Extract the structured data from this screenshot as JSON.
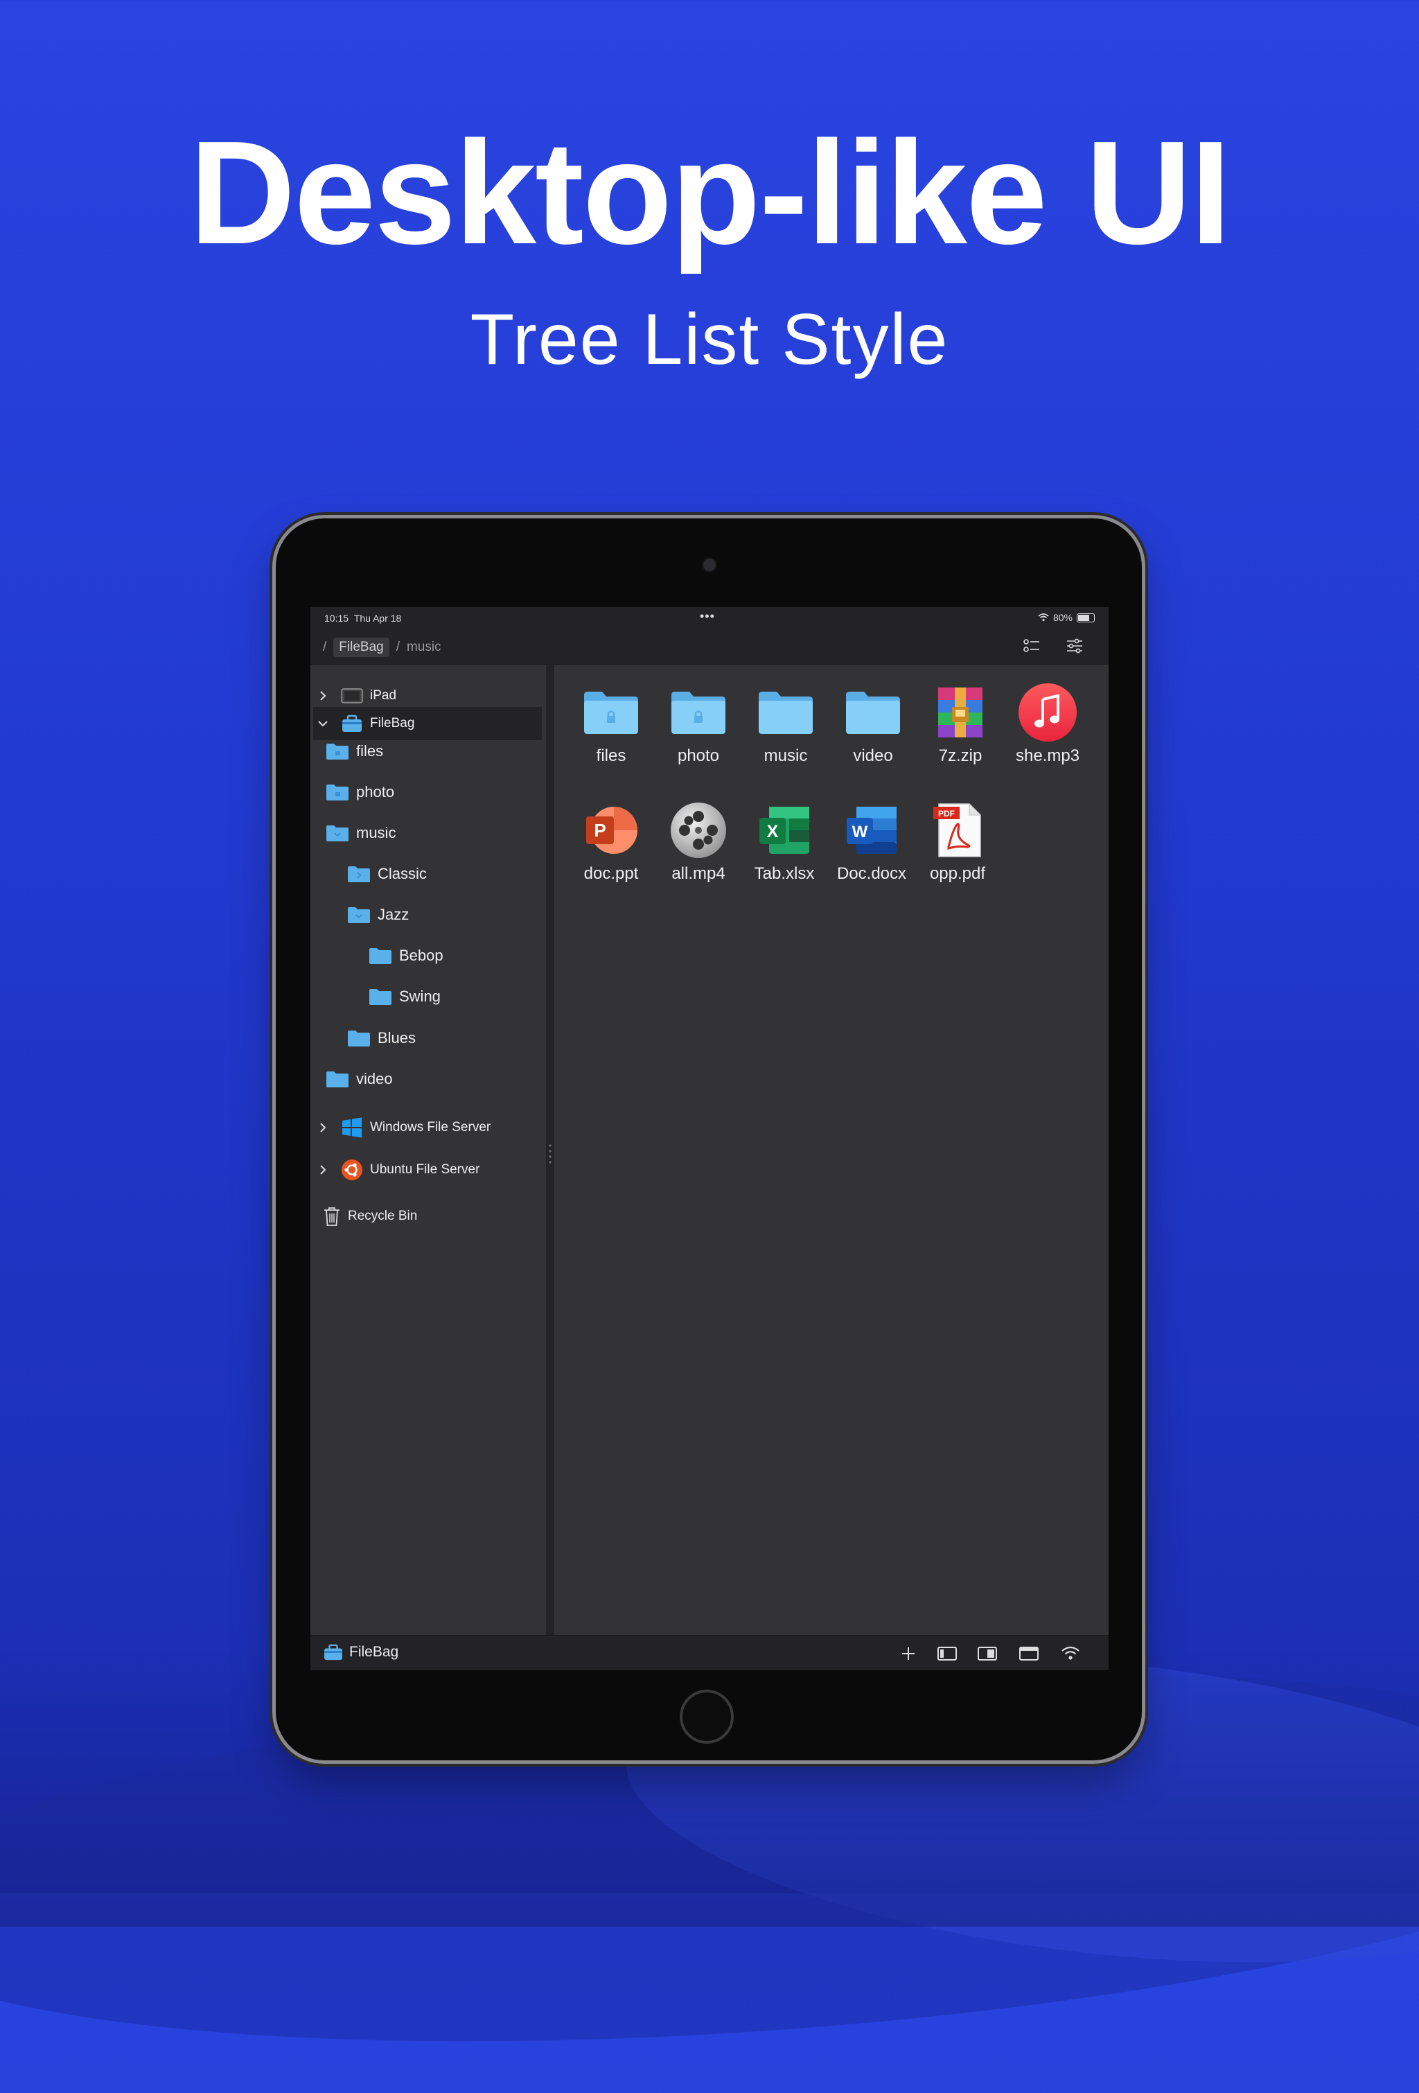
{
  "headline": {
    "title": "Desktop-like UI",
    "subtitle": "Tree List Style"
  },
  "status_bar": {
    "time": "10:15",
    "date": "Thu Apr 18",
    "battery": "80%",
    "more": "•••"
  },
  "breadcrumb": {
    "sep": "/",
    "root": "FileBag",
    "current": "music"
  },
  "sidebar": {
    "ipad": "iPad",
    "filebag": "FileBag",
    "files": "files",
    "photo": "photo",
    "music": "music",
    "classic": "Classic",
    "jazz": "Jazz",
    "bebop": "Bebop",
    "swing": "Swing",
    "blues": "Blues",
    "video": "video",
    "windows": "Windows File Server",
    "ubuntu": "Ubuntu File Server",
    "recycle": "Recycle Bin"
  },
  "grid": [
    {
      "label": "files",
      "icon": "folder-lock-icon"
    },
    {
      "label": "photo",
      "icon": "folder-lock-icon"
    },
    {
      "label": "music",
      "icon": "folder-icon"
    },
    {
      "label": "video",
      "icon": "folder-icon"
    },
    {
      "label": "7z.zip",
      "icon": "archive-icon"
    },
    {
      "label": "she.mp3",
      "icon": "music-file-icon"
    },
    {
      "label": "doc.ppt",
      "icon": "powerpoint-icon"
    },
    {
      "label": "all.mp4",
      "icon": "film-reel-icon"
    },
    {
      "label": "Tab.xlsx",
      "icon": "excel-icon"
    },
    {
      "label": "Doc.docx",
      "icon": "word-icon"
    },
    {
      "label": "opp.pdf",
      "icon": "pdf-icon"
    }
  ],
  "bottom_bar": {
    "location": "FileBag"
  },
  "colors": {
    "background": "#2a44e0",
    "panel": "#333335",
    "bar": "#232325",
    "folder": "#5ab0ea"
  }
}
